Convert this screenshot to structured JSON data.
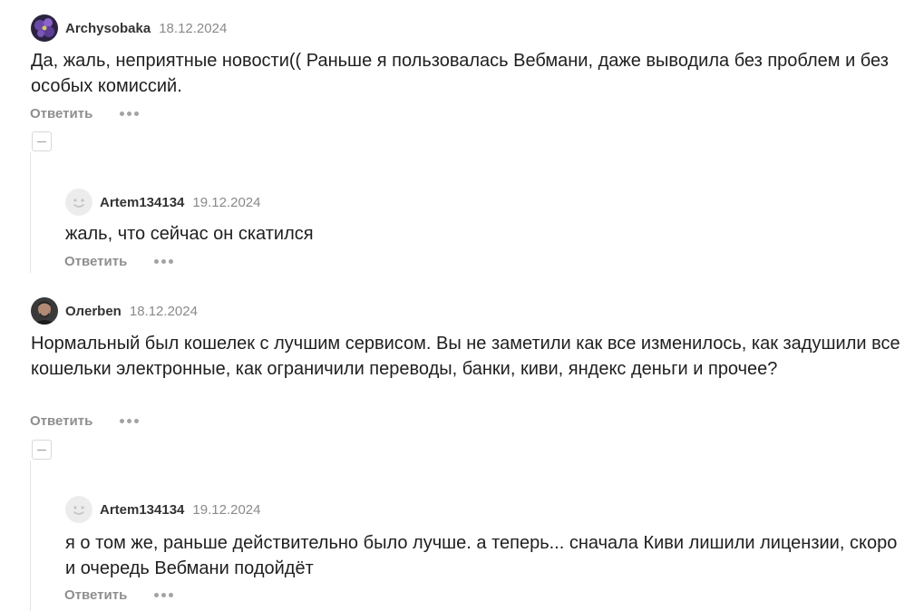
{
  "comments": [
    {
      "author": "Archysobaka",
      "date": "18.12.2024",
      "avatar_icon": "purple-flower-avatar",
      "text": "Да, жаль, неприятные новости(( Раньше я пользовалась Вебмани, даже выводила без проблем и без особых комиссий.",
      "reply_label": "Ответить",
      "replies": [
        {
          "author": "Artem134134",
          "date": "19.12.2024",
          "avatar_icon": "default-smiley-avatar",
          "text": "жаль, что сейчас он скатился",
          "reply_label": "Ответить"
        }
      ]
    },
    {
      "author": "Олerben",
      "date": "18.12.2024",
      "avatar_icon": "man-photo-avatar",
      "text": "Нормальный был кошелек с лучшим сервисом. Вы не заметили как все изменилось, как задушили все кошельки электронные, как ограничили переводы, банки, киви, яндекс деньги и прочее?",
      "reply_label": "Ответить",
      "replies": [
        {
          "author": "Artem134134",
          "date": "19.12.2024",
          "avatar_icon": "default-smiley-avatar",
          "text": "я о том же, раньше действительно было лучше. а теперь... сначала Киви лишили лицензии, скоро и очередь Вебмани подойдёт",
          "reply_label": "Ответить"
        }
      ]
    }
  ]
}
